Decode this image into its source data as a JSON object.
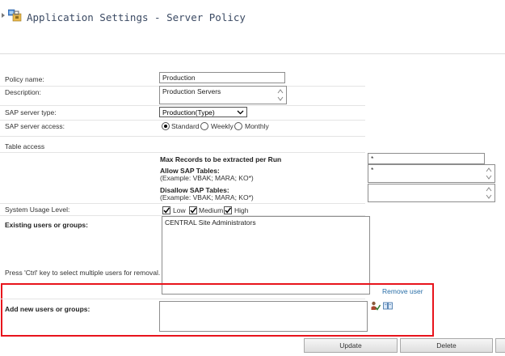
{
  "page": {
    "title": "Application Settings - Server Policy"
  },
  "fields": {
    "policy_name": {
      "label": "Policy name:",
      "value": "Production"
    },
    "description": {
      "label": "Description:",
      "value": "Production Servers"
    },
    "server_type": {
      "label": "SAP server type:",
      "value": "Production(Type)"
    },
    "server_access": {
      "label": "SAP server access:",
      "options": [
        "Standard",
        "Weekly",
        "Monthly"
      ],
      "selected": "Standard"
    },
    "table_access": {
      "label": "Table access",
      "max_records_label": "Max Records to be extracted per Run",
      "max_records_value": "*",
      "allow_label": "Allow SAP Tables:",
      "allow_example": "(Example: VBAK; MARA; KO*)",
      "allow_value": "*",
      "disallow_label": "Disallow SAP Tables:",
      "disallow_example": "(Example: VBAK; MARA; KO*)",
      "disallow_value": ""
    },
    "usage_level": {
      "label": "System Usage Level:",
      "options": [
        {
          "label": "Low",
          "checked": true
        },
        {
          "label": "Medium",
          "checked": true
        },
        {
          "label": "High",
          "checked": true
        }
      ]
    },
    "existing_users": {
      "label": "Existing users or groups:",
      "hint": "Press 'Ctrl' key to select multiple users for removal.",
      "items": [
        "CENTRAL Site Administrators"
      ],
      "remove_link": "Remove user"
    },
    "add_users": {
      "label": "Add new users or groups:",
      "value": ""
    }
  },
  "buttons": {
    "update": "Update",
    "delete": "Delete"
  },
  "colors": {
    "highlight_border": "#e8141c",
    "title": "#3b4a63",
    "link": "#2a6fa8"
  },
  "icons": [
    "settings-app-icon",
    "check-names-icon",
    "browse-directory-icon"
  ]
}
